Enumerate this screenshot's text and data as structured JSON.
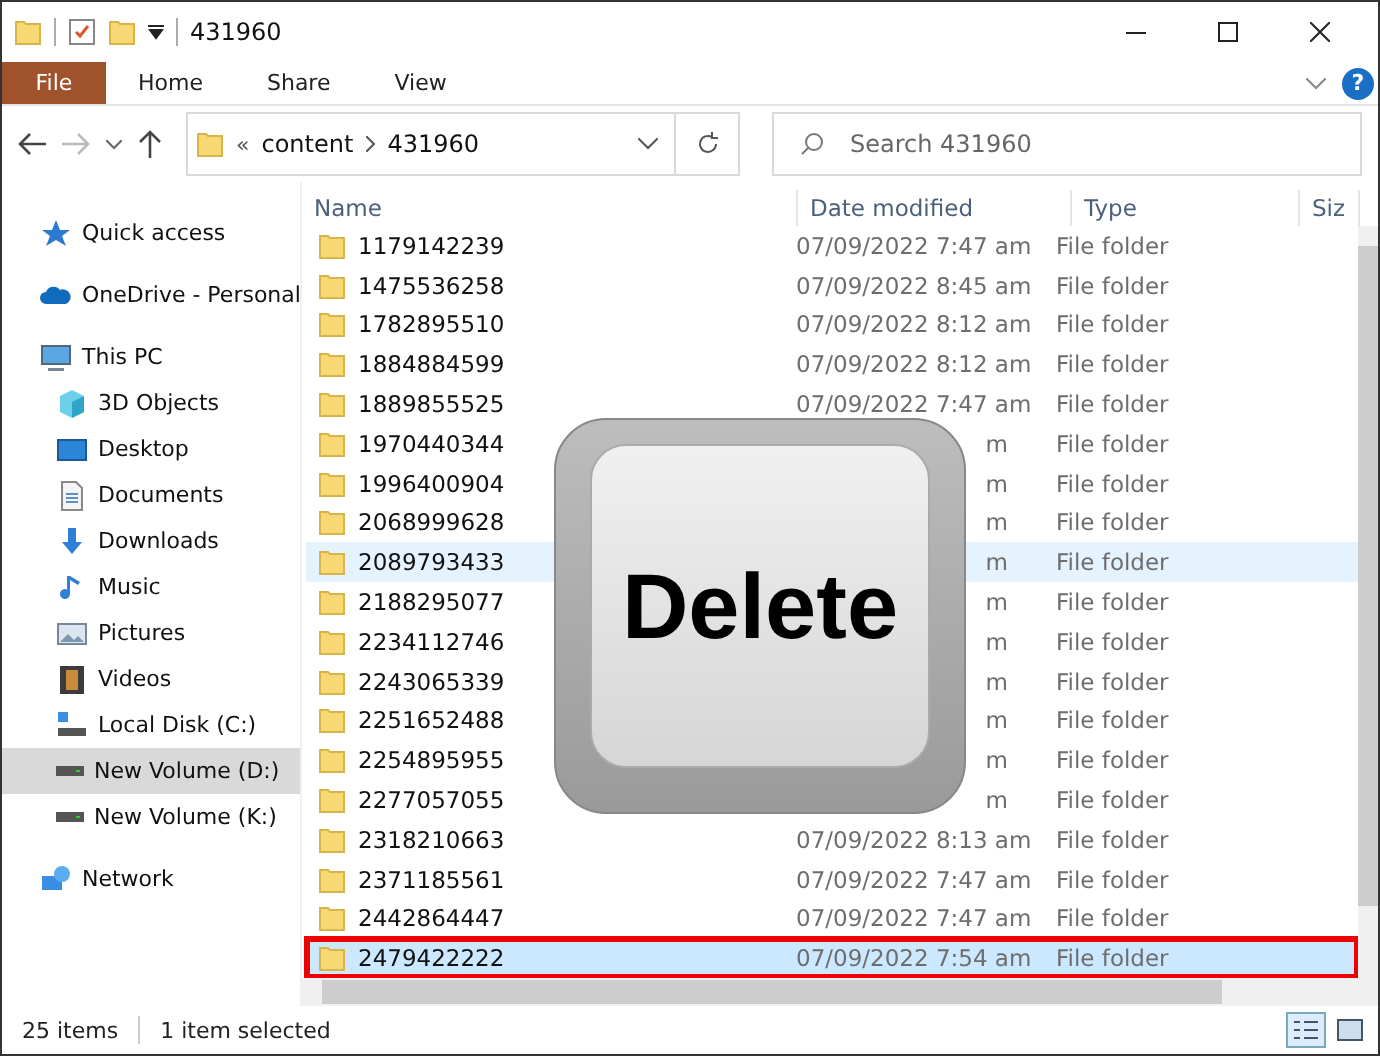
{
  "window": {
    "title": "431960"
  },
  "ribbon": {
    "tabs": [
      {
        "label": "File",
        "selected": true
      },
      {
        "label": "Home",
        "selected": false
      },
      {
        "label": "Share",
        "selected": false
      },
      {
        "label": "View",
        "selected": false
      }
    ],
    "help": "?"
  },
  "address": {
    "separator": "«",
    "crumbs": [
      "content",
      "431960"
    ],
    "search_placeholder": "Search 431960"
  },
  "sidebar": {
    "items": [
      {
        "label": "Quick access",
        "kind": "star",
        "selected": false
      },
      {
        "label": "OneDrive - Personal",
        "kind": "cloud",
        "selected": false
      },
      {
        "label": "This PC",
        "kind": "pc",
        "selected": false,
        "children": [
          {
            "label": "3D Objects",
            "kind": "cube",
            "selected": false
          },
          {
            "label": "Desktop",
            "kind": "desktop",
            "selected": false
          },
          {
            "label": "Documents",
            "kind": "document",
            "selected": false
          },
          {
            "label": "Downloads",
            "kind": "download",
            "selected": false
          },
          {
            "label": "Music",
            "kind": "music",
            "selected": false
          },
          {
            "label": "Pictures",
            "kind": "picture",
            "selected": false
          },
          {
            "label": "Videos",
            "kind": "video",
            "selected": false
          },
          {
            "label": "Local Disk (C:)",
            "kind": "disk",
            "selected": false
          },
          {
            "label": "New Volume (D:)",
            "kind": "drive",
            "selected": true
          },
          {
            "label": "New Volume (K:)",
            "kind": "drive",
            "selected": false
          }
        ]
      },
      {
        "label": "Network",
        "kind": "network",
        "selected": false
      }
    ]
  },
  "table": {
    "columns": [
      "Name",
      "Date modified",
      "Type",
      "Siz"
    ],
    "rows": [
      {
        "name": "1179142239",
        "date": "07/09/2022 7:47 am",
        "type": "File folder",
        "selected": false,
        "hovered": false
      },
      {
        "name": "1475536258",
        "date": "07/09/2022 8:45 am",
        "type": "File folder",
        "selected": false,
        "hovered": false
      },
      {
        "name": "1782895510",
        "date": "07/09/2022 8:12 am",
        "type": "File folder",
        "selected": false,
        "hovered": false
      },
      {
        "name": "1884884599",
        "date": "07/09/2022 8:12 am",
        "type": "File folder",
        "selected": false,
        "hovered": false
      },
      {
        "name": "1889855525",
        "date": "07/09/2022 7:47 am",
        "type": "File folder",
        "selected": false,
        "hovered": false
      },
      {
        "name": "1970440344",
        "date": "m",
        "type": "File folder",
        "selected": false,
        "hovered": false
      },
      {
        "name": "1996400904",
        "date": "m",
        "type": "File folder",
        "selected": false,
        "hovered": false
      },
      {
        "name": "2068999628",
        "date": "m",
        "type": "File folder",
        "selected": false,
        "hovered": false
      },
      {
        "name": "2089793433",
        "date": "m",
        "type": "File folder",
        "selected": false,
        "hovered": true
      },
      {
        "name": "2188295077",
        "date": "m",
        "type": "File folder",
        "selected": false,
        "hovered": false
      },
      {
        "name": "2234112746",
        "date": "m",
        "type": "File folder",
        "selected": false,
        "hovered": false
      },
      {
        "name": "2243065339",
        "date": "m",
        "type": "File folder",
        "selected": false,
        "hovered": false
      },
      {
        "name": "2251652488",
        "date": "m",
        "type": "File folder",
        "selected": false,
        "hovered": false
      },
      {
        "name": "2254895955",
        "date": "m",
        "type": "File folder",
        "selected": false,
        "hovered": false
      },
      {
        "name": "2277057055",
        "date": "m",
        "type": "File folder",
        "selected": false,
        "hovered": false
      },
      {
        "name": "2318210663",
        "date": "07/09/2022 8:13 am",
        "type": "File folder",
        "selected": false,
        "hovered": false
      },
      {
        "name": "2371185561",
        "date": "07/09/2022 7:47 am",
        "type": "File folder",
        "selected": false,
        "hovered": false
      },
      {
        "name": "2442864447",
        "date": "07/09/2022 7:47 am",
        "type": "File folder",
        "selected": false,
        "hovered": false
      },
      {
        "name": "2479422222",
        "date": "07/09/2022 7:54 am",
        "type": "File folder",
        "selected": true,
        "hovered": false
      }
    ]
  },
  "overlay": {
    "key_label": "Delete"
  },
  "status_bar": {
    "count": "25 items",
    "selection": "1 item selected"
  }
}
